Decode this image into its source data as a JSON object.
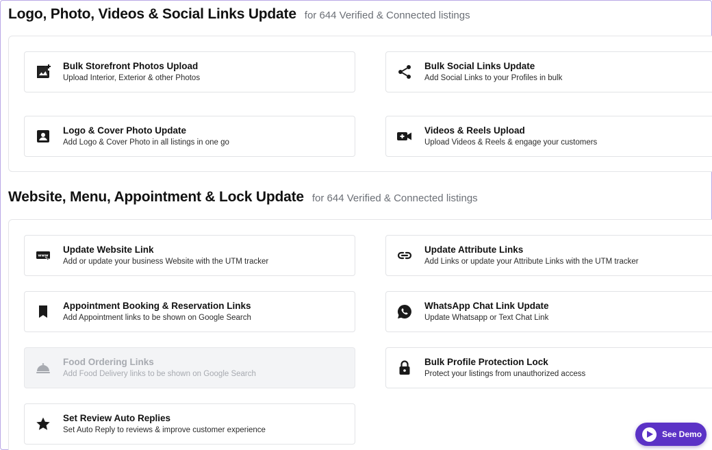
{
  "section1": {
    "title": "Logo, Photo, Videos & Social Links Update",
    "subtitle": "for 644 Verified & Connected listings",
    "cards": [
      {
        "title": "Bulk Storefront Photos Upload",
        "desc": "Upload Interior, Exterior & other Photos",
        "icon": "add-photo-icon"
      },
      {
        "title": "Bulk Social Links Update",
        "desc": "Add Social Links to your Profiles in bulk",
        "icon": "share-icon"
      },
      {
        "title": "Logo & Cover Photo Update",
        "desc": "Add Logo & Cover Photo in all listings in one go",
        "icon": "portrait-icon"
      },
      {
        "title": "Videos & Reels Upload",
        "desc": "Upload Videos & Reels & engage your customers",
        "icon": "video-camera-icon"
      }
    ]
  },
  "section2": {
    "title": "Website, Menu, Appointment & Lock Update",
    "subtitle": "for 644 Verified & Connected listings",
    "cards": [
      {
        "title": "Update Website Link",
        "desc": "Add or update your business Website with the UTM tracker",
        "icon": "www-icon"
      },
      {
        "title": "Update Attribute Links",
        "desc": "Add Links or update your Attribute Links with the UTM tracker",
        "icon": "link-icon"
      },
      {
        "title": "Appointment Booking & Reservation Links",
        "desc": "Add Appointment links to be shown on Google Search",
        "icon": "bookmark-icon"
      },
      {
        "title": "WhatsApp Chat Link Update",
        "desc": "Update Whatsapp or Text Chat Link",
        "icon": "whatsapp-icon"
      },
      {
        "title": "Food Ordering Links",
        "desc": "Add Food Delivery links to be shown on Google Search",
        "icon": "cloche-icon",
        "disabled": true
      },
      {
        "title": "Bulk Profile Protection Lock",
        "desc": "Protect your listings from unauthorized access",
        "icon": "lock-icon"
      },
      {
        "title": "Set Review Auto Replies",
        "desc": "Set Auto Reply to reviews & improve customer experience",
        "icon": "star-icon"
      }
    ]
  },
  "demo_button": {
    "label": "See Demo",
    "color": "#5b32c6"
  }
}
